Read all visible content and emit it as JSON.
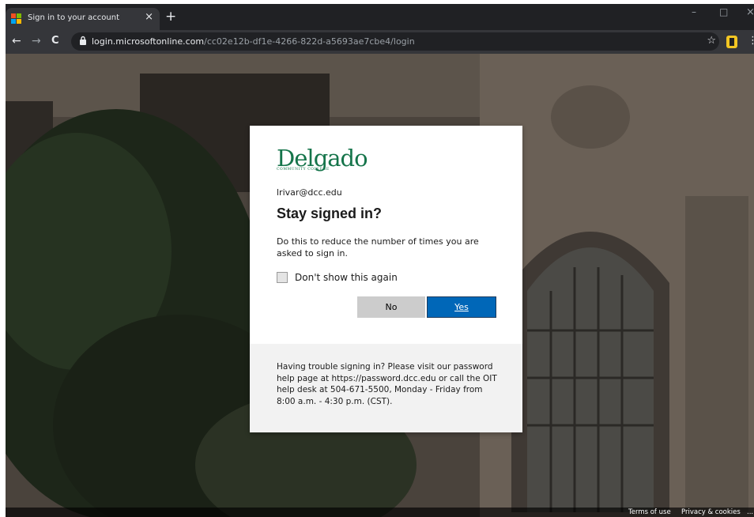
{
  "browser": {
    "tab_title": "Sign in to your account",
    "tab_close": "×",
    "new_tab": "+",
    "url_host": "login.microsoftonline.com",
    "url_path": "/cc02e12b-df1e-4266-822d-a5693ae7cbe4/login",
    "back": "←",
    "forward": "→",
    "reload": "C",
    "star": "☆",
    "menu": "⋮",
    "minimize": "–",
    "maximize": "□",
    "close": "×"
  },
  "dialog": {
    "logo_text": "Delgado",
    "logo_subtext": "COMMUNITY COLLEGE",
    "email": "lrivar@dcc.edu",
    "heading": "Stay signed in?",
    "description": "Do this to reduce the number of times you are asked to sign in.",
    "checkbox_label": "Don't show this again",
    "no_label": "No",
    "yes_label": "Yes",
    "help_text": "Having trouble signing in? Please visit our password help page at https://password.dcc.edu or call the OIT help desk at 504-671-5500, Monday - Friday from 8:00 a.m. - 4:30 p.m. (CST)."
  },
  "footer": {
    "terms": "Terms of use",
    "privacy": "Privacy & cookies",
    "more": "..."
  },
  "colors": {
    "brand_green": "#15744a",
    "primary_button": "#0067b8"
  }
}
